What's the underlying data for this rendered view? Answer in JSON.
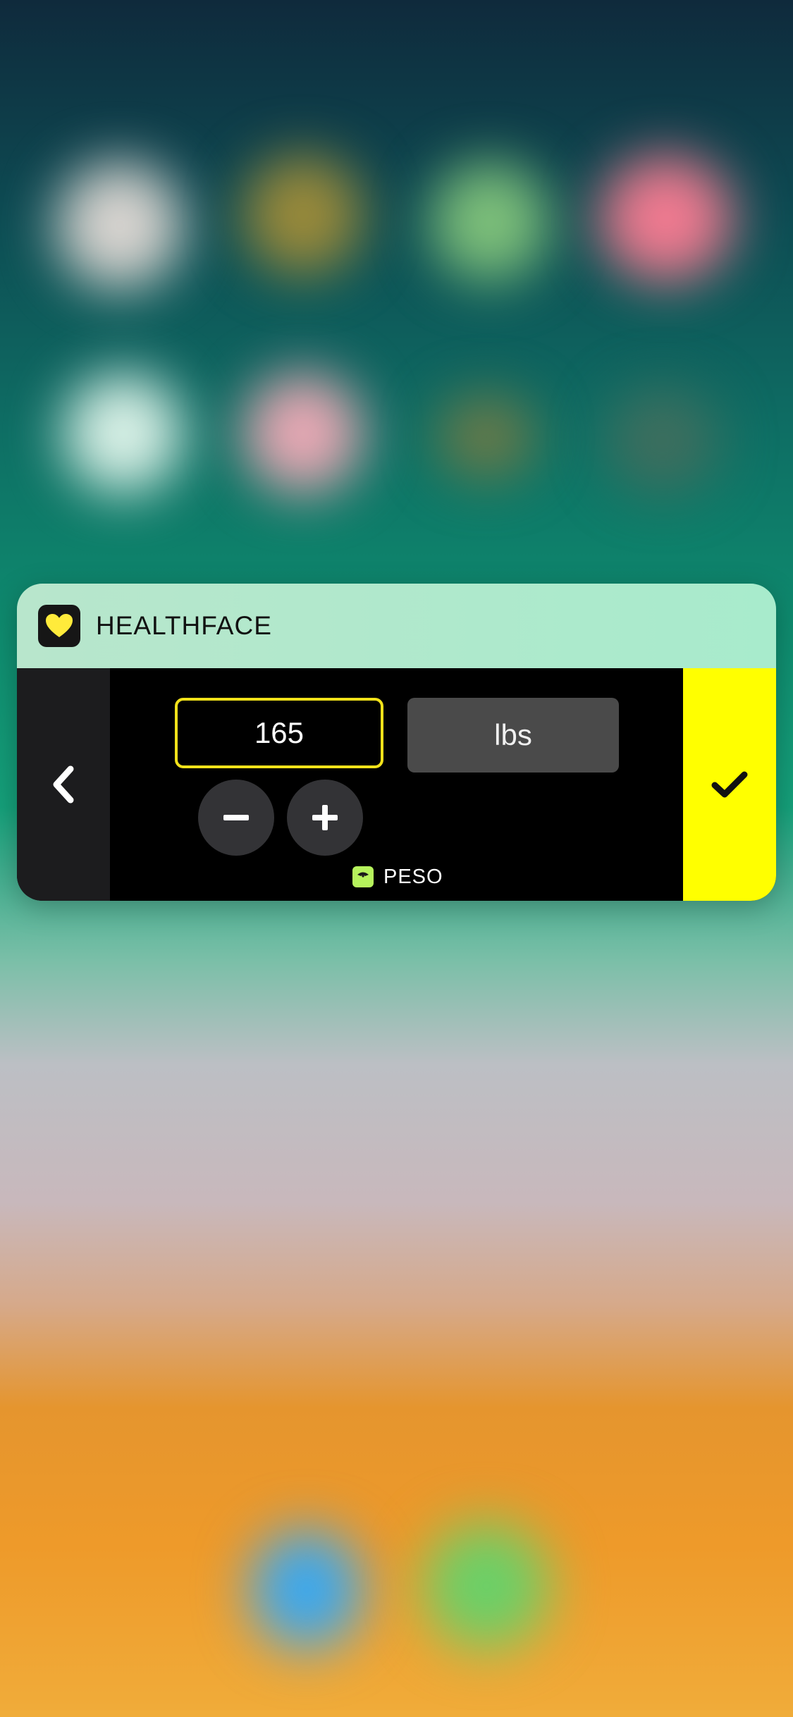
{
  "widget": {
    "app_name": "HEALTHFACE",
    "value": "165",
    "unit": "lbs",
    "metric_label": "PESO"
  },
  "icons": {
    "app": "heart-icon",
    "back": "chevron-left-icon",
    "confirm": "checkmark-icon",
    "decrement": "minus-icon",
    "increment": "plus-icon",
    "metric": "scale-icon"
  },
  "colors": {
    "accent": "#ffff00",
    "header_background": "#a8ebcc",
    "field_border": "#f2e21a",
    "scale_icon": "#b6f35c"
  }
}
